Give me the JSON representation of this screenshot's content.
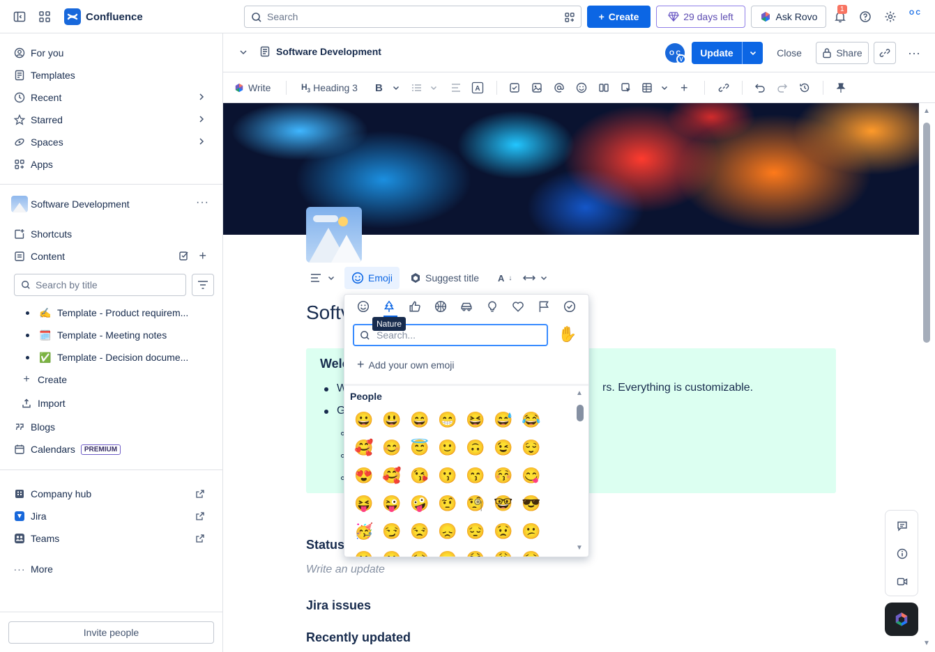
{
  "app": {
    "name": "Confluence",
    "search_placeholder": "Search",
    "create_label": "Create",
    "trial_label": "29 days left",
    "rovo_label": "Ask Rovo",
    "notifications_count": "1",
    "avatar_initials": "O C"
  },
  "sidebar": {
    "nav": [
      {
        "label": "For you",
        "icon": "user-circle-icon"
      },
      {
        "label": "Templates",
        "icon": "template-icon"
      },
      {
        "label": "Recent",
        "icon": "clock-icon"
      },
      {
        "label": "Starred",
        "icon": "star-icon"
      },
      {
        "label": "Spaces",
        "icon": "spaces-icon"
      },
      {
        "label": "Apps",
        "icon": "apps-icon"
      }
    ],
    "space_name": "Software Development",
    "shortcuts_label": "Shortcuts",
    "content_label": "Content",
    "search_title_placeholder": "Search by title",
    "tree": [
      {
        "emoji": "✍️",
        "label": "Template - Product requirem..."
      },
      {
        "emoji": "🗓️",
        "label": "Template - Meeting notes"
      },
      {
        "emoji": "✅",
        "label": "Template - Decision docume..."
      }
    ],
    "create_label": "Create",
    "import_label": "Import",
    "blogs_label": "Blogs",
    "calendars_label": "Calendars",
    "premium_badge": "PREMIUM",
    "links": [
      {
        "label": "Company hub"
      },
      {
        "label": "Jira"
      },
      {
        "label": "Teams"
      }
    ],
    "more_label": "More",
    "invite_label": "Invite people"
  },
  "page_header": {
    "title": "Software Development",
    "avatar": "O C",
    "avatar_badge": "V",
    "update_label": "Update",
    "close_label": "Close",
    "share_label": "Share"
  },
  "toolbar": {
    "write_label": "Write",
    "heading_label": "Heading 3"
  },
  "title_tools": {
    "emoji_label": "Emoji",
    "suggest_label": "Suggest title"
  },
  "content": {
    "title_visible": "Softv",
    "panel_heading": "Welc",
    "panel_line1_start": "W",
    "panel_line1_end": "rs. Everything is customizable.",
    "panel_line2_start": "G",
    "status_heading": "Status",
    "status_placeholder": "Write an update",
    "jira_heading": "Jira issues",
    "recent_heading": "Recently updated"
  },
  "emoji_picker": {
    "tooltip": "Nature",
    "search_placeholder": "Search...",
    "skin_tone": "✋",
    "add_own_label": "Add your own emoji",
    "category_heading": "People",
    "categories": [
      "smiley-icon",
      "tree-icon",
      "thumbs-up-icon",
      "ball-icon",
      "car-icon",
      "bulb-icon",
      "heart-icon",
      "flag-icon",
      "check-circle-icon"
    ],
    "active_category": 1,
    "emojis": [
      [
        "😀",
        "😃",
        "😄",
        "😁",
        "😆",
        "😅",
        "😂"
      ],
      [
        "🥰",
        "😊",
        "😇",
        "🙂",
        "🙃",
        "😉",
        "😌"
      ],
      [
        "😍",
        "🥰",
        "😘",
        "😗",
        "😙",
        "😚",
        "😋"
      ],
      [
        "😝",
        "😜",
        "🤪",
        "🤨",
        "🧐",
        "🤓",
        "😎"
      ],
      [
        "🥳",
        "😏",
        "😒",
        "😞",
        "😔",
        "😟",
        "😕"
      ],
      [
        "🙁",
        "☹️",
        "😣",
        "😖",
        "😫",
        "😩",
        "🥺"
      ]
    ]
  }
}
